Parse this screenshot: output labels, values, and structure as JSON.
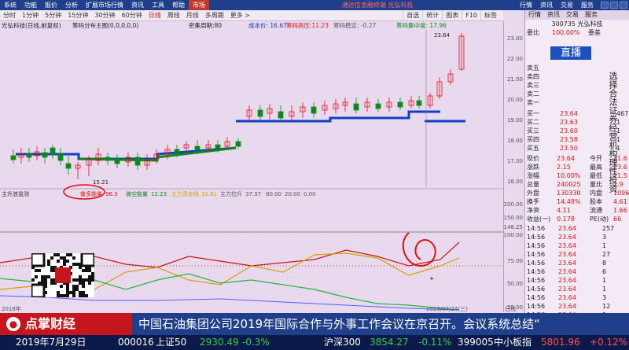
{
  "menu": {
    "items": [
      "系统",
      "功能",
      "报价",
      "分析",
      "扩展市场行情",
      "资讯",
      "工具",
      "帮助"
    ],
    "market_tab": "市场",
    "center_text": "通达信金融终端 光弘科技",
    "right_items": [
      "行情",
      "资讯",
      "交易",
      "服务"
    ]
  },
  "toolbar": {
    "periods": [
      "分时",
      "1分钟",
      "5分钟",
      "15分钟",
      "30分钟",
      "60分钟",
      "日线",
      "周线",
      "月线",
      "多周期",
      "更多 >"
    ],
    "active": "日线",
    "right": [
      "自选",
      "统计",
      "图表",
      "F10",
      "标签"
    ]
  },
  "chart": {
    "title": "光弘科技(日线,前复权)",
    "indicator": "筹码分布主图(0,0,0,0,0)",
    "label_mid": "密集周期:80",
    "label_profit": "成本价: 16.67",
    "label_high_cost": "筹码高压:11.23",
    "label_stable": "筹码稳定: -0.27",
    "label_top": "筹码集中度: 17.96",
    "price_high_label": "23.64",
    "price_low_label": "15.21",
    "lower_title": "主升浪监测",
    "lower_items": [
      {
        "label": "做多能量",
        "value": "96.3"
      },
      {
        "label": "做空能量",
        "value": "12.23"
      },
      {
        "label": "主力资金线",
        "value": "31.81"
      },
      {
        "label": "主力拉升",
        "value": "37.37"
      },
      {
        "label": "",
        "value": "80.00"
      },
      {
        "label": "",
        "value": "20.00"
      },
      {
        "label": "",
        "value": "0.00"
      }
    ],
    "right_axis": [
      "23.00",
      "22.00",
      "21.00",
      "20.00",
      "19.00",
      "18.00",
      "17.00",
      "16.00",
      "200.00",
      "150.00",
      "148.25",
      "100.00",
      "75.00",
      "50.00",
      "25.00"
    ],
    "date_left": "2018年",
    "date_right": "2019/07/24(三)",
    "bottom_tab": "日线"
  },
  "panel": {
    "tabs": [
      "委比",
      "委差"
    ],
    "code": "300735 光弘科技",
    "weibi": "100.00%",
    "weicha": "委差",
    "live_button": "直播",
    "vertical_text": "选择合法证券经营机构理性投资",
    "sells": [
      {
        "label": "卖五",
        "price": "",
        "vol": ""
      },
      {
        "label": "卖四",
        "price": "",
        "vol": ""
      },
      {
        "label": "卖三",
        "price": "",
        "vol": ""
      },
      {
        "label": "卖二",
        "price": "",
        "vol": ""
      },
      {
        "label": "卖一",
        "price": "",
        "vol": ""
      }
    ],
    "buys": [
      {
        "label": "买一",
        "price": "23.64",
        "vol": "467"
      },
      {
        "label": "买二",
        "price": "23.63",
        "vol": "1"
      },
      {
        "label": "买三",
        "price": "23.60",
        "vol": "1"
      },
      {
        "label": "买四",
        "price": "23.58",
        "vol": "1"
      },
      {
        "label": "买五",
        "price": "23.50",
        "vol": "1"
      }
    ],
    "stats": [
      {
        "k": "现价",
        "v": "23.64",
        "k2": "今开",
        "v2": "21.6"
      },
      {
        "k": "涨跌",
        "v": "2.15",
        "k2": "最高",
        "v2": "23.6"
      },
      {
        "k": "涨幅",
        "v": "10.00%",
        "k2": "最低",
        "v2": "21.5"
      },
      {
        "k": "总量",
        "v": "240025",
        "k2": "量比",
        "v2": "1.9"
      },
      {
        "k": "外盘",
        "v": "130330",
        "k2": "内盘",
        "v2": "10969"
      },
      {
        "k": "换手",
        "v": "14.48%",
        "k2": "股本",
        "v2": "4.61"
      },
      {
        "k": "净资",
        "v": "4.11",
        "k2": "流通",
        "v2": "1.66"
      },
      {
        "k": "收益(一)",
        "v": "0.178",
        "k2": "PE(动)",
        "v2": "66"
      }
    ],
    "ticks": [
      {
        "t": "14:56",
        "p": "23.64",
        "v": "257"
      },
      {
        "t": "14:56",
        "p": "23.64",
        "v": "3"
      },
      {
        "t": "14:56",
        "p": "23.64",
        "v": "1"
      },
      {
        "t": "14:56",
        "p": "23.64",
        "v": "27"
      },
      {
        "t": "14:56",
        "p": "23.64",
        "v": "8"
      },
      {
        "t": "14:56",
        "p": "23.64",
        "v": "6"
      },
      {
        "t": "14:56",
        "p": "23.64",
        "v": "1"
      },
      {
        "t": "14:56",
        "p": "23.64",
        "v": "1"
      },
      {
        "t": "14:56",
        "p": "23.64",
        "v": "3"
      },
      {
        "t": "14:56",
        "p": "23.64",
        "v": "12"
      },
      {
        "t": "14:56",
        "p": "23.64",
        "v": "1"
      },
      {
        "t": "14:56",
        "p": "23.64",
        "v": "3"
      }
    ]
  },
  "ticker": {
    "logo": "点掌财经",
    "headline": "中国石油集团公司2019年国际合作与外事工作会议在京召开。会议系统总结“"
  },
  "indexbar": {
    "date": "2019年7月29日",
    "items": [
      {
        "code": "000016",
        "name": "上证50",
        "value": "2930.49",
        "change": "-0.3%"
      },
      {
        "code": "",
        "name": "沪深300",
        "value": "3854.27",
        "change": "-0.11%"
      },
      {
        "code": "399005",
        "name": "中小板指",
        "value": "5801.96",
        "change": "+0.12%"
      }
    ]
  },
  "colors": {
    "up": "#e01010",
    "down": "#0a8a1a",
    "accent": "#1f3f8a",
    "brand": "#c4161c"
  }
}
